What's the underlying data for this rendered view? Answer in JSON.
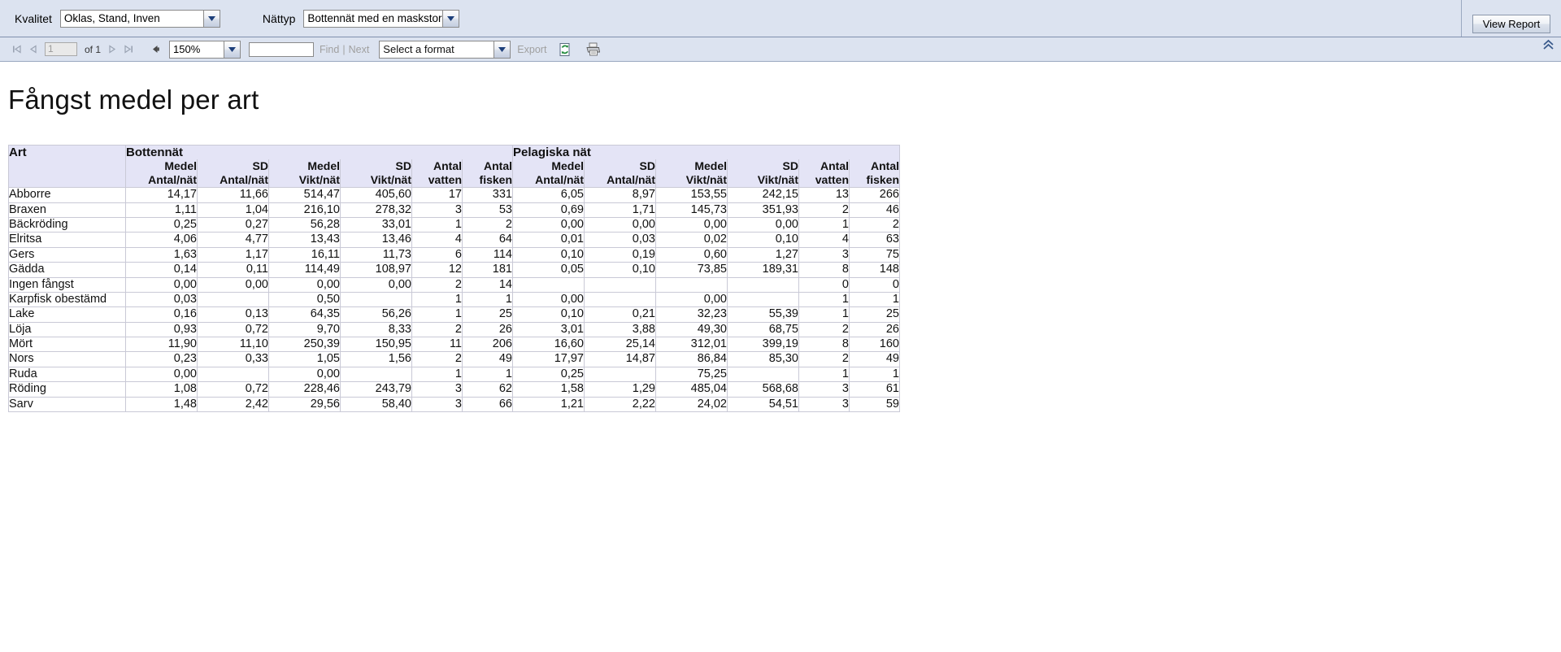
{
  "params": {
    "kvalitet": {
      "label": "Kvalitet",
      "value": "Oklas, Stand, Inven"
    },
    "nattyp": {
      "label": "Nättyp",
      "value": "Bottennät med en maskstorlek ("
    },
    "view_report_label": "View Report"
  },
  "toolbar": {
    "first_page_icon": "first-page-icon",
    "prev_page_icon": "previous-page-icon",
    "page_value": "1",
    "of_label": "of 1",
    "next_page_icon": "next-page-icon",
    "last_page_icon": "last-page-icon",
    "back_parent_icon": "back-to-parent-report-icon",
    "zoom_value": "150%",
    "find_value": "",
    "find_label": "Find",
    "find_separator": "|",
    "next_label": "Next",
    "format_value": "Select a format",
    "export_label": "Export",
    "refresh_icon": "refresh-icon",
    "print_icon": "print-icon",
    "collapse_icon": "collapse-toolbar-icon"
  },
  "report": {
    "title": "Fångst medel per art",
    "group_headers": {
      "art": "Art",
      "bottennat": "Bottennät",
      "pelagiska": "Pelagiska nät"
    },
    "sub_headers": [
      "Medel\nAntal/nät",
      "SD\nAntal/nät",
      "Medel\nVikt/nät",
      "SD\nVikt/nät",
      "Antal\nvatten",
      "Antal\nfisken"
    ],
    "sub_headers_lines": [
      [
        "Medel",
        "Antal/nät"
      ],
      [
        "SD",
        "Antal/nät"
      ],
      [
        "Medel",
        "Vikt/nät"
      ],
      [
        "SD",
        "Vikt/nät"
      ],
      [
        "Antal",
        "vatten"
      ],
      [
        "Antal",
        "fisken"
      ]
    ],
    "rows": [
      {
        "art": "Abborre",
        "b": [
          "14,17",
          "11,66",
          "514,47",
          "405,60",
          "17",
          "331"
        ],
        "p": [
          "6,05",
          "8,97",
          "153,55",
          "242,15",
          "13",
          "266"
        ]
      },
      {
        "art": "Braxen",
        "b": [
          "1,11",
          "1,04",
          "216,10",
          "278,32",
          "3",
          "53"
        ],
        "p": [
          "0,69",
          "1,71",
          "145,73",
          "351,93",
          "2",
          "46"
        ]
      },
      {
        "art": "Bäckröding",
        "b": [
          "0,25",
          "0,27",
          "56,28",
          "33,01",
          "1",
          "2"
        ],
        "p": [
          "0,00",
          "0,00",
          "0,00",
          "0,00",
          "1",
          "2"
        ]
      },
      {
        "art": "Elritsa",
        "b": [
          "4,06",
          "4,77",
          "13,43",
          "13,46",
          "4",
          "64"
        ],
        "p": [
          "0,01",
          "0,03",
          "0,02",
          "0,10",
          "4",
          "63"
        ]
      },
      {
        "art": "Gers",
        "b": [
          "1,63",
          "1,17",
          "16,11",
          "11,73",
          "6",
          "114"
        ],
        "p": [
          "0,10",
          "0,19",
          "0,60",
          "1,27",
          "3",
          "75"
        ]
      },
      {
        "art": "Gädda",
        "b": [
          "0,14",
          "0,11",
          "114,49",
          "108,97",
          "12",
          "181"
        ],
        "p": [
          "0,05",
          "0,10",
          "73,85",
          "189,31",
          "8",
          "148"
        ]
      },
      {
        "art": "Ingen fångst",
        "b": [
          "0,00",
          "0,00",
          "0,00",
          "0,00",
          "2",
          "14"
        ],
        "p": [
          "",
          "",
          "",
          "",
          "0",
          "0"
        ]
      },
      {
        "art": "Karpfisk obestämd",
        "b": [
          "0,03",
          "",
          "0,50",
          "",
          "1",
          "1"
        ],
        "p": [
          "0,00",
          "",
          "0,00",
          "",
          "1",
          "1"
        ]
      },
      {
        "art": "Lake",
        "b": [
          "0,16",
          "0,13",
          "64,35",
          "56,26",
          "1",
          "25"
        ],
        "p": [
          "0,10",
          "0,21",
          "32,23",
          "55,39",
          "1",
          "25"
        ]
      },
      {
        "art": "Löja",
        "b": [
          "0,93",
          "0,72",
          "9,70",
          "8,33",
          "2",
          "26"
        ],
        "p": [
          "3,01",
          "3,88",
          "49,30",
          "68,75",
          "2",
          "26"
        ]
      },
      {
        "art": "Mört",
        "b": [
          "11,90",
          "11,10",
          "250,39",
          "150,95",
          "11",
          "206"
        ],
        "p": [
          "16,60",
          "25,14",
          "312,01",
          "399,19",
          "8",
          "160"
        ]
      },
      {
        "art": "Nors",
        "b": [
          "0,23",
          "0,33",
          "1,05",
          "1,56",
          "2",
          "49"
        ],
        "p": [
          "17,97",
          "14,87",
          "86,84",
          "85,30",
          "2",
          "49"
        ]
      },
      {
        "art": "Ruda",
        "b": [
          "0,00",
          "",
          "0,00",
          "",
          "1",
          "1"
        ],
        "p": [
          "0,25",
          "",
          "75,25",
          "",
          "1",
          "1"
        ]
      },
      {
        "art": "Röding",
        "b": [
          "1,08",
          "0,72",
          "228,46",
          "243,79",
          "3",
          "62"
        ],
        "p": [
          "1,58",
          "1,29",
          "485,04",
          "568,68",
          "3",
          "61"
        ]
      },
      {
        "art": "Sarv",
        "b": [
          "1,48",
          "2,42",
          "29,56",
          "58,40",
          "3",
          "66"
        ],
        "p": [
          "1,21",
          "2,22",
          "24,02",
          "54,51",
          "3",
          "59"
        ]
      }
    ]
  },
  "colors": {
    "header_bg": "#e4e4f6",
    "chrome_bg": "#dce3f0",
    "grid_line": "#c9c9d6",
    "disabled_text": "#a0a0a0"
  }
}
